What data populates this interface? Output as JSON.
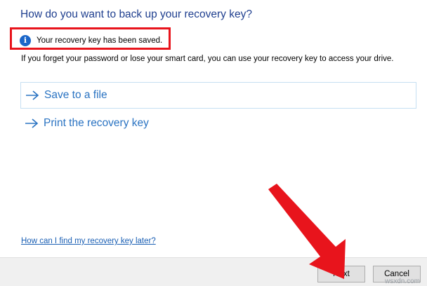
{
  "dialog": {
    "heading": "How do you want to back up your recovery key?",
    "saved_notice": "Your recovery key has been saved.",
    "description": "If you forget your password or lose your smart card, you can use your recovery key to access your drive.",
    "options": [
      {
        "label": "Save to a file",
        "selected": true
      },
      {
        "label": "Print the recovery key",
        "selected": false
      }
    ],
    "help_link": "How can I find my recovery key later?"
  },
  "footer": {
    "next_label": "Next",
    "cancel_label": "Cancel"
  },
  "icons": {
    "info": "info-icon",
    "option_arrow": "arrow-right-icon"
  },
  "colors": {
    "heading": "#1f3f8f",
    "link_blue": "#2a73c2",
    "highlight_red": "#e8141c",
    "info_blue": "#1a66c9"
  },
  "watermark": "wsxdn.com"
}
